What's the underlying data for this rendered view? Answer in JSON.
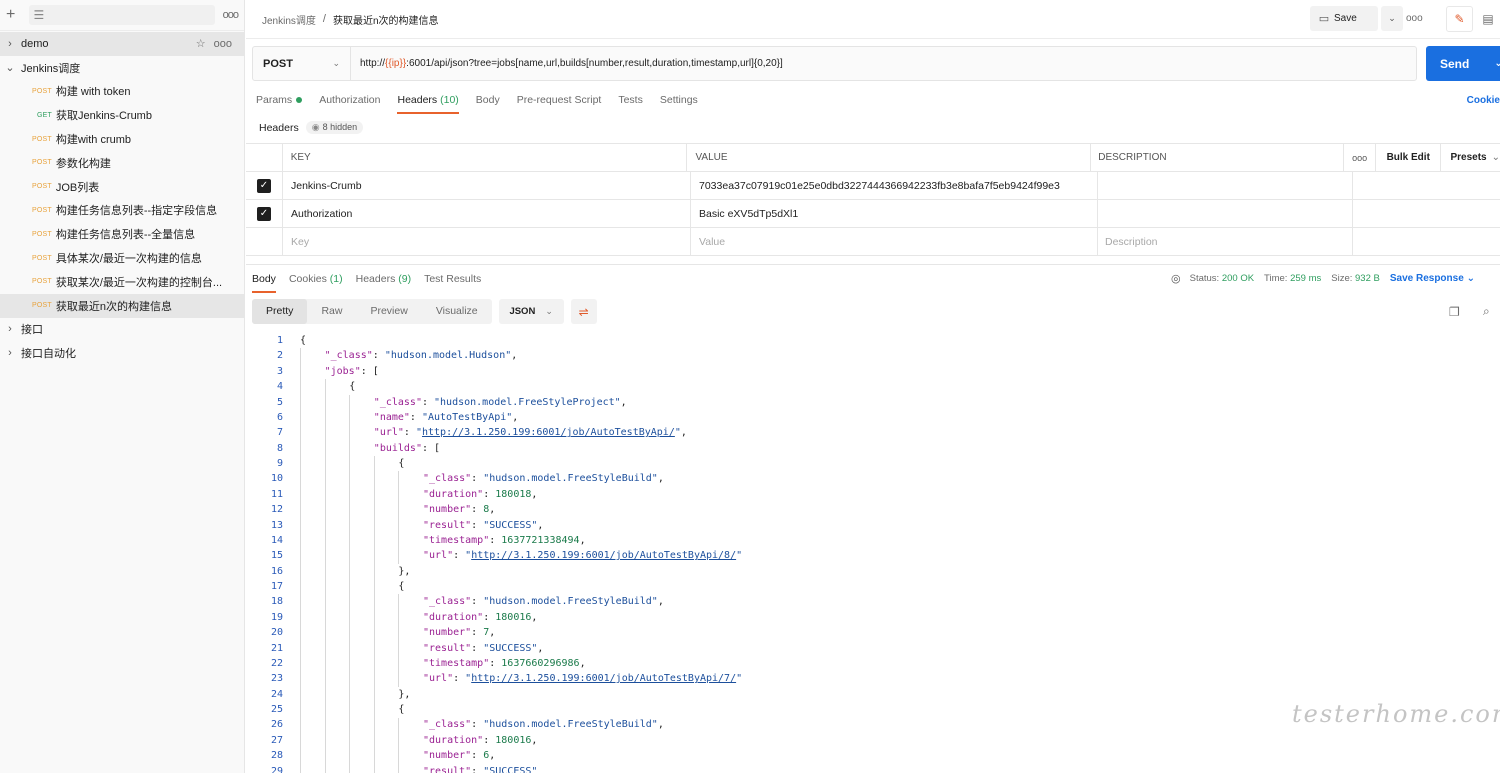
{
  "sidebar": {
    "plus_icon": "plus-icon",
    "filter_icon": "filter-icon",
    "more": "ooo",
    "tree": [
      {
        "type": "collection",
        "label": "demo",
        "expanded": false
      },
      {
        "type": "collection",
        "label": "Jenkins调度",
        "expanded": true
      },
      {
        "type": "request",
        "method": "POST",
        "label": "构建 with token"
      },
      {
        "type": "request",
        "method": "GET",
        "label": "获取Jenkins-Crumb"
      },
      {
        "type": "request",
        "method": "POST",
        "label": "构建with crumb"
      },
      {
        "type": "request",
        "method": "POST",
        "label": "参数化构建"
      },
      {
        "type": "request",
        "method": "POST",
        "label": "JOB列表"
      },
      {
        "type": "request",
        "method": "POST",
        "label": "构建任务信息列表--指定字段信息"
      },
      {
        "type": "request",
        "method": "POST",
        "label": "构建任务信息列表--全量信息"
      },
      {
        "type": "request",
        "method": "POST",
        "label": "具体某次/最近一次构建的信息"
      },
      {
        "type": "request",
        "method": "POST",
        "label": "获取某次/最近一次构建的控制台..."
      },
      {
        "type": "request",
        "method": "POST",
        "label": "获取最近n次的构建信息",
        "selected": true
      },
      {
        "type": "collection",
        "label": "接口",
        "expanded": false
      },
      {
        "type": "collection",
        "label": "接口自动化",
        "expanded": false
      }
    ]
  },
  "topbar": {
    "breadcrumb_parent": "Jenkins调度",
    "breadcrumb_sep": "/",
    "breadcrumb_current": "获取最近n次的构建信息",
    "save_label": "Save",
    "more": "ooo"
  },
  "request": {
    "method": "POST",
    "url_prefix": "http://",
    "url_var": "{{ip}}",
    "url_suffix": ":6001/api/json?tree=jobs[name,url,builds[number,result,duration,timestamp,url]{0,20}]",
    "send_label": "Send"
  },
  "req_tabs": [
    {
      "label": "Params",
      "count": "",
      "dot": true
    },
    {
      "label": "Authorization",
      "count": ""
    },
    {
      "label": "Headers",
      "count": "(10)",
      "active": true
    },
    {
      "label": "Body",
      "count": ""
    },
    {
      "label": "Pre-request Script",
      "count": ""
    },
    {
      "label": "Tests",
      "count": ""
    },
    {
      "label": "Settings",
      "count": ""
    }
  ],
  "cookies_link": "Cookie",
  "headers_section": {
    "title": "Headers",
    "hidden": "8 hidden"
  },
  "headers_table": {
    "cols": {
      "key": "KEY",
      "value": "VALUE",
      "description": "DESCRIPTION",
      "more": "ooo",
      "bulk": "Bulk Edit",
      "presets": "Presets"
    },
    "rows": [
      {
        "checked": true,
        "key": "Jenkins-Crumb",
        "value": "7033ea37c07919c01e25e0dbd3227444366942233fb3e8bafa7f5eb9424f99e3",
        "description": ""
      },
      {
        "checked": true,
        "key": "Authorization",
        "value": "Basic eXV5dTp5dXl1",
        "description": ""
      }
    ],
    "placeholder": {
      "key": "Key",
      "value": "Value",
      "description": "Description"
    }
  },
  "response": {
    "tabs": [
      {
        "label": "Body",
        "count": "",
        "active": true
      },
      {
        "label": "Cookies",
        "count": "(1)"
      },
      {
        "label": "Headers",
        "count": "(9)"
      },
      {
        "label": "Test Results",
        "count": ""
      }
    ],
    "status_label": "Status:",
    "status": "200 OK",
    "time_label": "Time:",
    "time": "259 ms",
    "size_label": "Size:",
    "size": "932 B",
    "save_response": "Save Response",
    "views": [
      "Pretty",
      "Raw",
      "Preview",
      "Visualize"
    ],
    "format": "JSON"
  },
  "code_lines": [
    {
      "n": "1",
      "indent": 0,
      "parts": [
        [
          "p",
          "{"
        ]
      ]
    },
    {
      "n": "2",
      "indent": 1,
      "parts": [
        [
          "k",
          "\"_class\""
        ],
        [
          "p",
          ": "
        ],
        [
          "s",
          "\"hudson.model.Hudson\""
        ],
        [
          "p",
          ","
        ]
      ]
    },
    {
      "n": "3",
      "indent": 1,
      "parts": [
        [
          "k",
          "\"jobs\""
        ],
        [
          "p",
          ": ["
        ]
      ]
    },
    {
      "n": "4",
      "indent": 2,
      "parts": [
        [
          "p",
          "{"
        ]
      ]
    },
    {
      "n": "5",
      "indent": 3,
      "parts": [
        [
          "k",
          "\"_class\""
        ],
        [
          "p",
          ": "
        ],
        [
          "s",
          "\"hudson.model.FreeStyleProject\""
        ],
        [
          "p",
          ","
        ]
      ]
    },
    {
      "n": "6",
      "indent": 3,
      "parts": [
        [
          "k",
          "\"name\""
        ],
        [
          "p",
          ": "
        ],
        [
          "s",
          "\"AutoTestByApi\""
        ],
        [
          "p",
          ","
        ]
      ]
    },
    {
      "n": "7",
      "indent": 3,
      "parts": [
        [
          "k",
          "\"url\""
        ],
        [
          "p",
          ": "
        ],
        [
          "s",
          "\""
        ],
        [
          "u",
          "http://3.1.250.199:6001/job/AutoTestByApi/"
        ],
        [
          "s",
          "\""
        ],
        [
          "p",
          ","
        ]
      ]
    },
    {
      "n": "8",
      "indent": 3,
      "parts": [
        [
          "k",
          "\"builds\""
        ],
        [
          "p",
          ": ["
        ]
      ]
    },
    {
      "n": "9",
      "indent": 4,
      "parts": [
        [
          "p",
          "{"
        ]
      ]
    },
    {
      "n": "10",
      "indent": 5,
      "parts": [
        [
          "k",
          "\"_class\""
        ],
        [
          "p",
          ": "
        ],
        [
          "s",
          "\"hudson.model.FreeStyleBuild\""
        ],
        [
          "p",
          ","
        ]
      ]
    },
    {
      "n": "11",
      "indent": 5,
      "parts": [
        [
          "k",
          "\"duration\""
        ],
        [
          "p",
          ": "
        ],
        [
          "n",
          "180018"
        ],
        [
          "p",
          ","
        ]
      ]
    },
    {
      "n": "12",
      "indent": 5,
      "parts": [
        [
          "k",
          "\"number\""
        ],
        [
          "p",
          ": "
        ],
        [
          "n",
          "8"
        ],
        [
          "p",
          ","
        ]
      ]
    },
    {
      "n": "13",
      "indent": 5,
      "parts": [
        [
          "k",
          "\"result\""
        ],
        [
          "p",
          ": "
        ],
        [
          "s",
          "\"SUCCESS\""
        ],
        [
          "p",
          ","
        ]
      ]
    },
    {
      "n": "14",
      "indent": 5,
      "parts": [
        [
          "k",
          "\"timestamp\""
        ],
        [
          "p",
          ": "
        ],
        [
          "n",
          "1637721338494"
        ],
        [
          "p",
          ","
        ]
      ]
    },
    {
      "n": "15",
      "indent": 5,
      "parts": [
        [
          "k",
          "\"url\""
        ],
        [
          "p",
          ": "
        ],
        [
          "s",
          "\""
        ],
        [
          "u",
          "http://3.1.250.199:6001/job/AutoTestByApi/8/"
        ],
        [
          "s",
          "\""
        ]
      ]
    },
    {
      "n": "16",
      "indent": 4,
      "parts": [
        [
          "p",
          "},"
        ]
      ]
    },
    {
      "n": "17",
      "indent": 4,
      "parts": [
        [
          "p",
          "{"
        ]
      ]
    },
    {
      "n": "18",
      "indent": 5,
      "parts": [
        [
          "k",
          "\"_class\""
        ],
        [
          "p",
          ": "
        ],
        [
          "s",
          "\"hudson.model.FreeStyleBuild\""
        ],
        [
          "p",
          ","
        ]
      ]
    },
    {
      "n": "19",
      "indent": 5,
      "parts": [
        [
          "k",
          "\"duration\""
        ],
        [
          "p",
          ": "
        ],
        [
          "n",
          "180016"
        ],
        [
          "p",
          ","
        ]
      ]
    },
    {
      "n": "20",
      "indent": 5,
      "parts": [
        [
          "k",
          "\"number\""
        ],
        [
          "p",
          ": "
        ],
        [
          "n",
          "7"
        ],
        [
          "p",
          ","
        ]
      ]
    },
    {
      "n": "21",
      "indent": 5,
      "parts": [
        [
          "k",
          "\"result\""
        ],
        [
          "p",
          ": "
        ],
        [
          "s",
          "\"SUCCESS\""
        ],
        [
          "p",
          ","
        ]
      ]
    },
    {
      "n": "22",
      "indent": 5,
      "parts": [
        [
          "k",
          "\"timestamp\""
        ],
        [
          "p",
          ": "
        ],
        [
          "n",
          "1637660296986"
        ],
        [
          "p",
          ","
        ]
      ]
    },
    {
      "n": "23",
      "indent": 5,
      "parts": [
        [
          "k",
          "\"url\""
        ],
        [
          "p",
          ": "
        ],
        [
          "s",
          "\""
        ],
        [
          "u",
          "http://3.1.250.199:6001/job/AutoTestByApi/7/"
        ],
        [
          "s",
          "\""
        ]
      ]
    },
    {
      "n": "24",
      "indent": 4,
      "parts": [
        [
          "p",
          "},"
        ]
      ]
    },
    {
      "n": "25",
      "indent": 4,
      "parts": [
        [
          "p",
          "{"
        ]
      ]
    },
    {
      "n": "26",
      "indent": 5,
      "parts": [
        [
          "k",
          "\"_class\""
        ],
        [
          "p",
          ": "
        ],
        [
          "s",
          "\"hudson.model.FreeStyleBuild\""
        ],
        [
          "p",
          ","
        ]
      ]
    },
    {
      "n": "27",
      "indent": 5,
      "parts": [
        [
          "k",
          "\"duration\""
        ],
        [
          "p",
          ": "
        ],
        [
          "n",
          "180016"
        ],
        [
          "p",
          ","
        ]
      ]
    },
    {
      "n": "28",
      "indent": 5,
      "parts": [
        [
          "k",
          "\"number\""
        ],
        [
          "p",
          ": "
        ],
        [
          "n",
          "6"
        ],
        [
          "p",
          ","
        ]
      ]
    },
    {
      "n": "29",
      "indent": 5,
      "parts": [
        [
          "k",
          "\"result\""
        ],
        [
          "p",
          ": "
        ],
        [
          "s",
          "\"SUCCESS\""
        ]
      ]
    }
  ],
  "watermark": "testerhome.com",
  "colors": {
    "accent": "#e8622c",
    "send": "#1a6fe0",
    "post": "#e8a33d",
    "get": "#2f9e5f"
  }
}
